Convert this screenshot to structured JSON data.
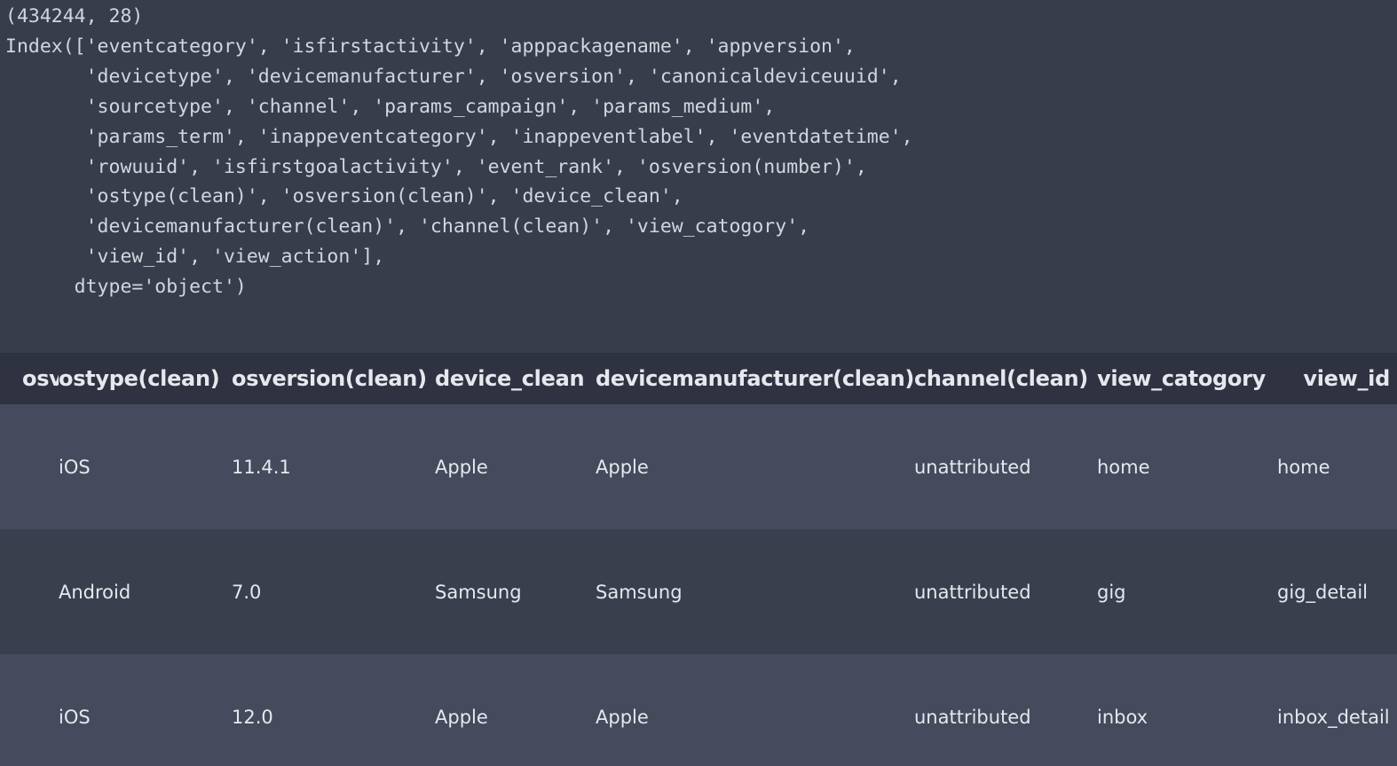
{
  "output": {
    "lines": [
      "(434244, 28)",
      "Index(['eventcategory', 'isfirstactivity', 'apppackagename', 'appversion',",
      "       'devicetype', 'devicemanufacturer', 'osversion', 'canonicaldeviceuuid',",
      "       'sourcetype', 'channel', 'params_campaign', 'params_medium',",
      "       'params_term', 'inappeventcategory', 'inappeventlabel', 'eventdatetime',",
      "       'rowuuid', 'isfirstgoalactivity', 'event_rank', 'osversion(number)',",
      "       'ostype(clean)', 'osversion(clean)', 'device_clean',",
      "       'devicemanufacturer(clean)', 'channel(clean)', 'view_catogory',",
      "       'view_id', 'view_action'],",
      "      dtype='object')"
    ]
  },
  "table": {
    "columns": [
      "osversion(number)",
      "ostype(clean)",
      "osversion(clean)",
      "device_clean",
      "devicemanufacturer(clean)",
      "channel(clean)",
      "view_catogory",
      "view_id"
    ],
    "rows": [
      [
        "",
        "iOS",
        "11.4.1",
        "Apple",
        "Apple",
        "unattributed",
        "home",
        "home"
      ],
      [
        "",
        "Android",
        "7.0",
        "Samsung",
        "Samsung",
        "unattributed",
        "gig",
        "gig_detail"
      ],
      [
        "",
        "iOS",
        "12.0",
        "Apple",
        "Apple",
        "unattributed",
        "inbox",
        "inbox_detail"
      ]
    ]
  }
}
